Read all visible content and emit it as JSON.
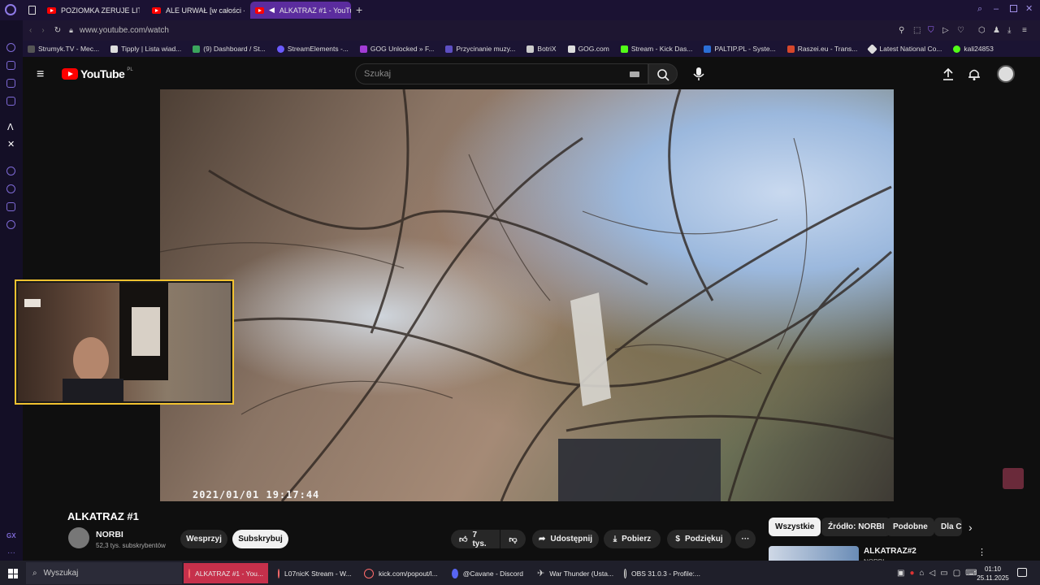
{
  "browser": {
    "tabs": [
      {
        "label": "POZIOMKA ZERUJE LITR",
        "active": false
      },
      {
        "label": "ALE URWAŁ [w całości -",
        "active": false
      },
      {
        "label": "ALKATRAZ #1 - YouTu",
        "active": true
      }
    ],
    "url": "www.youtube.com/watch",
    "bookmarks": [
      "Strumyk.TV - Mec...",
      "Tipply | Lista wiad...",
      "(9) Dashboard / St...",
      "StreamElements -...",
      "GOG Unlocked » F...",
      "Przycinanie muzy...",
      "BotriX",
      "GOG.com",
      "Stream - Kick Das...",
      "PALTIP.PL - Syste...",
      "Raszei.eu - Trans...",
      "Latest National Co...",
      "kali24853"
    ]
  },
  "youtube": {
    "logo_text": "YouTube",
    "logo_region": "PL",
    "search_placeholder": "Szukaj",
    "video": {
      "timestamp": "2021/01/01  19:17:44",
      "title": "ALKATRAZ #1"
    },
    "channel": {
      "name": "NORBI",
      "subscribers": "52,3 tys. subskrybentów",
      "support_label": "Wesprzyj",
      "subscribe_label": "Subskrybuj"
    },
    "actions": {
      "likes": "7 tys.",
      "share": "Udostępnij",
      "download": "Pobierz",
      "thanks": "Podziękuj"
    },
    "chips": [
      "Wszystkie",
      "Źródło: NORBI",
      "Podobne",
      "Dla C"
    ],
    "recommended": {
      "title": "ALKATRAZ#2",
      "channel": "NORBI"
    }
  },
  "taskbar": {
    "search_placeholder": "Wyszukaj",
    "items": [
      "ALKATRAZ #1 - You...",
      "L07nicK Stream - W...",
      "kick.com/popout/l...",
      "@Cavane - Discord",
      "War Thunder (Usta...",
      "OBS 31.0.3 - Profile:..."
    ],
    "time": "01:10",
    "date": "25.11.2025"
  },
  "colors": {
    "accent_purple": "#5b2c9e",
    "youtube_red": "#ff0000",
    "webcam_border": "#f2c230"
  }
}
